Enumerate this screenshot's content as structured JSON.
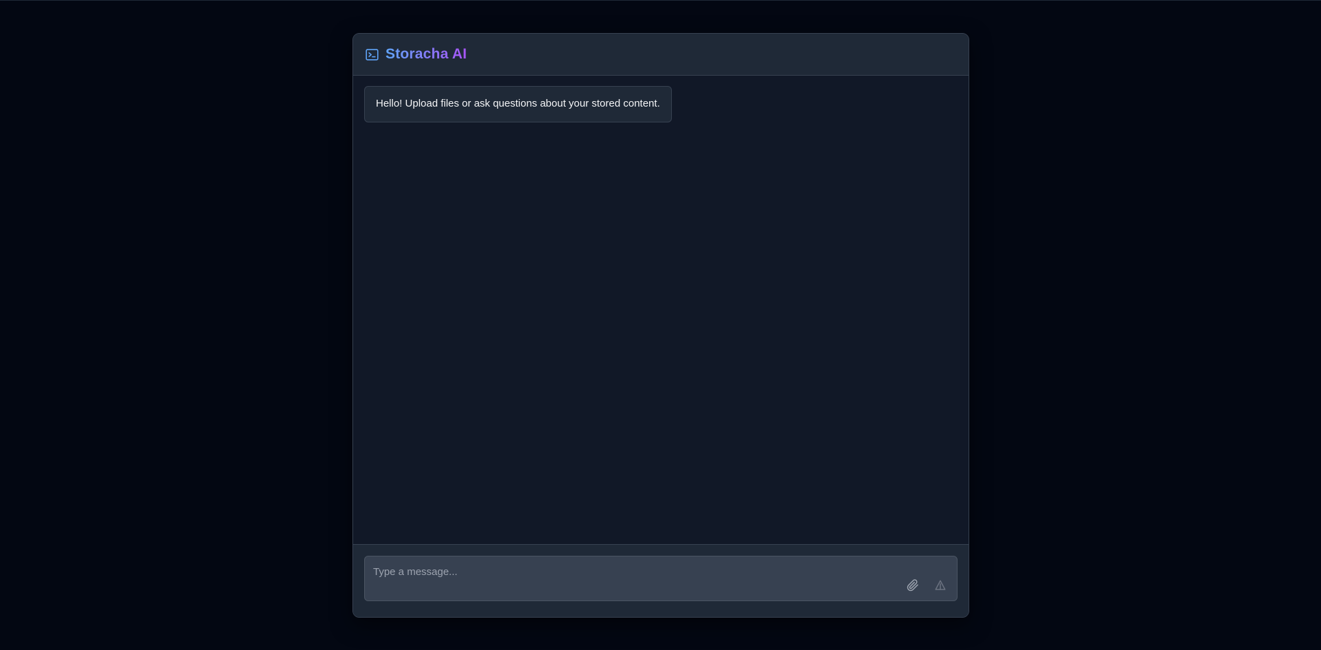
{
  "app": {
    "title": "Storacha AI",
    "icon": "terminal-icon"
  },
  "messages": [
    {
      "role": "assistant",
      "text": "Hello! Upload files or ask questions about your stored content."
    }
  ],
  "composer": {
    "placeholder": "Type a message...",
    "value": "",
    "attach_icon": "paperclip-icon",
    "send_icon": "send-icon"
  },
  "colors": {
    "page_background": "#030712",
    "panel_background": "#111827",
    "header_background": "#1f2937",
    "border": "#374151",
    "title_gradient_start": "#60a5fa",
    "title_gradient_end": "#a855f7",
    "icon_accent": "#60a5fa"
  }
}
